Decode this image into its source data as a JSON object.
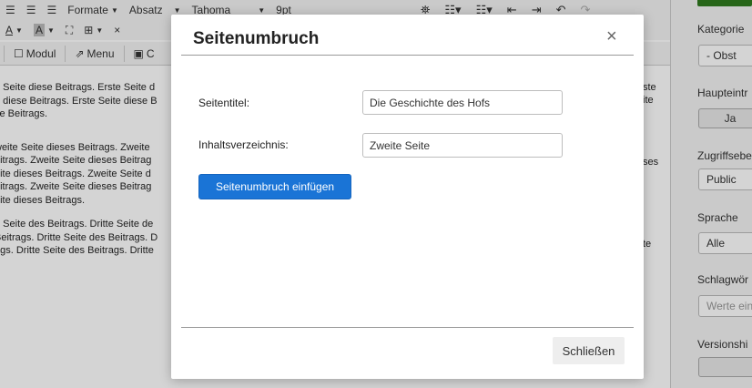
{
  "toolbar": {
    "row1": {
      "format_label": "Formate",
      "paragraph_label": "Absatz",
      "font_label": "Tahoma",
      "size_label": "9pt"
    },
    "row2": {
      "underline_label": "A",
      "bgcolor_label": "A"
    },
    "row3": {
      "module_label": "Modul",
      "menu_label": "Menu",
      "contact_label": "C"
    }
  },
  "content": {
    "paragraphs": [
      [
        "e Seite diese Beitrags. Erste Seite d",
        "e diese Beitrags. Erste Seite diese B",
        "se Beitrags."
      ],
      [
        "weite Seite dieses Beitrags. Zweite",
        "eitrags. Zweite Seite dieses Beitrag",
        "eite dieses Beitrags. Zweite Seite d",
        "eitrags. Zweite Seite dieses Beitrag",
        "eite dieses Beitrags."
      ],
      [
        "e Seite des Beitrags. Dritte Seite de",
        "Beitrags. Dritte Seite des Beitrags. D",
        "ags. Dritte Seite des Beitrags. Dritte"
      ]
    ],
    "right_fragments": [
      "ste",
      "ite",
      "ses",
      "te"
    ]
  },
  "sidebar": {
    "category_label": "Kategorie",
    "category_value": "- Obst",
    "featured_label": "Hauptеintr",
    "featured_value": "Ja",
    "access_label": "Zugriffsebe",
    "access_value": "Public",
    "language_label": "Sprache",
    "language_value": "Alle",
    "tags_label": "Schlagwör",
    "tags_placeholder": "Werte ein",
    "version_label": "Versionshi"
  },
  "modal": {
    "title": "Seitenumbruch",
    "close_icon": "×",
    "page_title_label": "Seitentitel:",
    "page_title_value": "Die Geschichte des Hofs",
    "toc_label": "Inhaltsverzeichnis:",
    "toc_value": "Zweite Seite",
    "insert_button": "Seitenumbruch einfügen",
    "close_button": "Schließen"
  },
  "colors": {
    "primary_button": "#1a74d6",
    "save_button": "#2f7a1f"
  }
}
